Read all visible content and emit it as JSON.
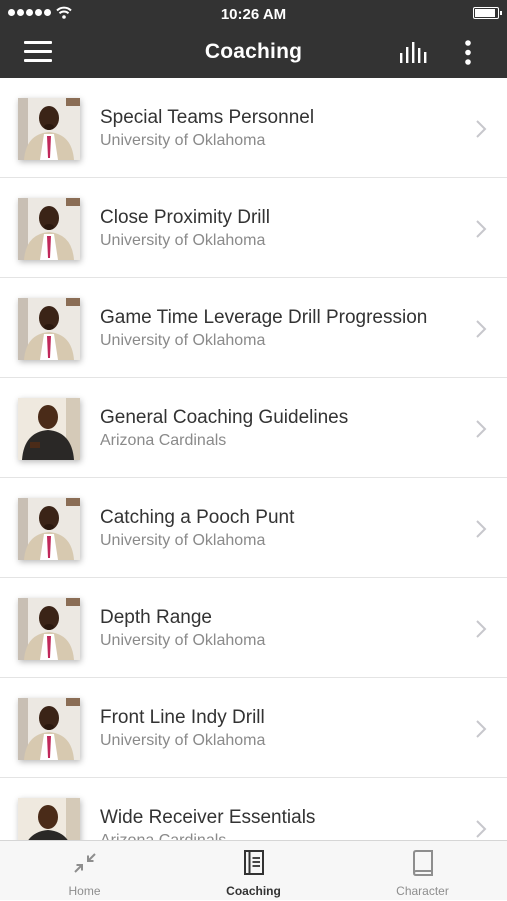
{
  "status_bar": {
    "time": "10:26 AM"
  },
  "header": {
    "title": "Coaching",
    "menu_icon": "hamburger-icon",
    "stats_icon": "bar-chart-icon",
    "more_icon": "more-vertical-icon"
  },
  "items": [
    {
      "title": "Special Teams Personnel",
      "subtitle": "University of Oklahoma",
      "thumb": "coach-a"
    },
    {
      "title": "Close Proximity Drill",
      "subtitle": "University of Oklahoma",
      "thumb": "coach-a"
    },
    {
      "title": "Game Time Leverage Drill Progression",
      "subtitle": "University of Oklahoma",
      "thumb": "coach-a"
    },
    {
      "title": "General Coaching Guidelines",
      "subtitle": "Arizona Cardinals",
      "thumb": "coach-b"
    },
    {
      "title": "Catching a Pooch Punt",
      "subtitle": "University of Oklahoma",
      "thumb": "coach-a"
    },
    {
      "title": "Depth Range",
      "subtitle": "University of Oklahoma",
      "thumb": "coach-a"
    },
    {
      "title": "Front Line Indy Drill",
      "subtitle": "University of Oklahoma",
      "thumb": "coach-a"
    },
    {
      "title": "Wide Receiver Essentials",
      "subtitle": "Arizona Cardinals",
      "thumb": "coach-b"
    }
  ],
  "tabs": [
    {
      "label": "Home",
      "icon": "collapse-arrows-icon",
      "active": false
    },
    {
      "label": "Coaching",
      "icon": "notebook-icon",
      "active": true
    },
    {
      "label": "Character",
      "icon": "book-icon",
      "active": false
    }
  ],
  "colors": {
    "header_bg": "#333333",
    "title_text": "#333333",
    "subtitle_text": "#8a8a8a",
    "tab_active": "#333333",
    "tab_inactive": "#8e8e8e"
  }
}
